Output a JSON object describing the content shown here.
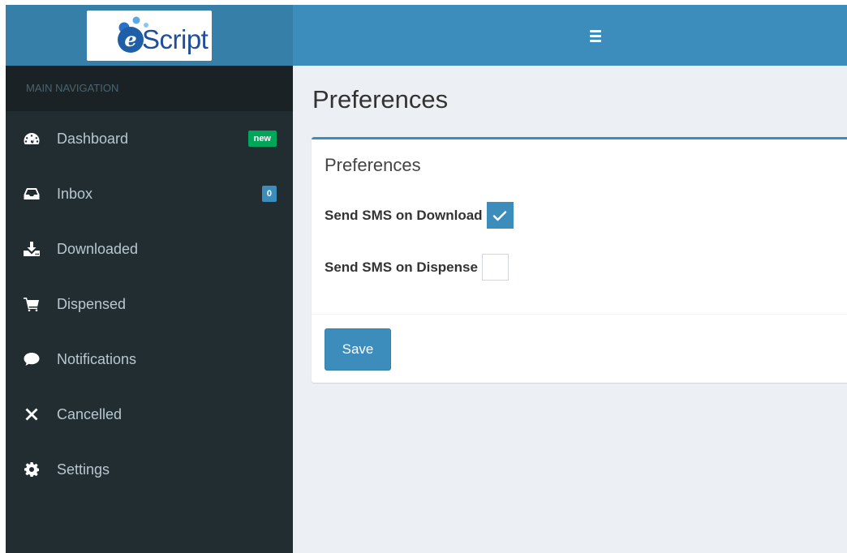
{
  "brand": {
    "logo_letter": "e",
    "logo_text": "Script"
  },
  "colors": {
    "header": "#3c8dbc",
    "logo_area": "#367fa9",
    "sidebar": "#222d32",
    "accent": "#3c8dbc",
    "badge_new": "#00a65a"
  },
  "sidebar": {
    "header": "MAIN NAVIGATION",
    "items": [
      {
        "label": "Dashboard",
        "icon": "dashboard-icon",
        "badge": "new"
      },
      {
        "label": "Inbox",
        "icon": "inbox-icon",
        "badge": "0"
      },
      {
        "label": "Downloaded",
        "icon": "download-icon"
      },
      {
        "label": "Dispensed",
        "icon": "cart-icon"
      },
      {
        "label": "Notifications",
        "icon": "comment-icon"
      },
      {
        "label": "Cancelled",
        "icon": "close-icon"
      },
      {
        "label": "Settings",
        "icon": "gear-icon"
      }
    ]
  },
  "header": {
    "toggle_icon": "hamburger-icon"
  },
  "main": {
    "page_title": "Preferences",
    "box": {
      "title": "Preferences",
      "fields": [
        {
          "label": "Send SMS on Download",
          "checked": true
        },
        {
          "label": "Send SMS on Dispense",
          "checked": false
        }
      ],
      "save_label": "Save"
    }
  }
}
